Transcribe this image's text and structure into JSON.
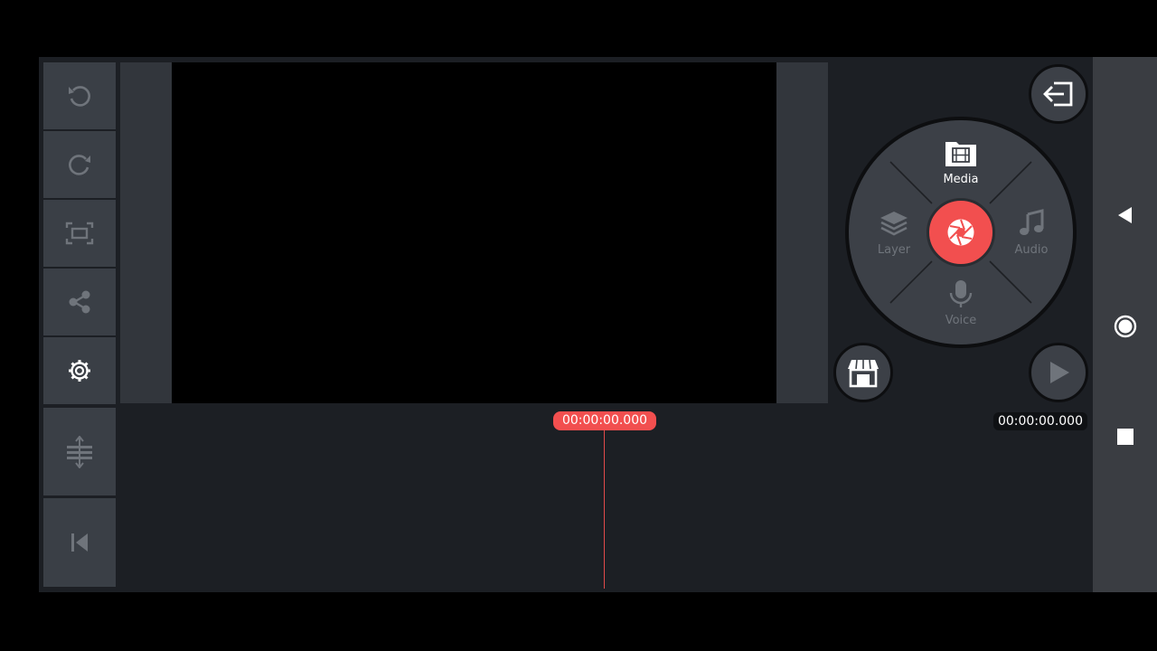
{
  "toolbar": {
    "undo_icon": "undo-icon",
    "redo_icon": "redo-icon",
    "capture_frame_icon": "capture-frame-icon",
    "share_icon": "share-icon",
    "settings_icon": "gear-icon"
  },
  "timeline_tools": {
    "adjust_icon": "adjust-tracks-icon",
    "jump_start_icon": "skip-to-start-icon"
  },
  "wheel": {
    "media": "Media",
    "layer": "Layer",
    "audio": "Audio",
    "voice": "Voice"
  },
  "timeline": {
    "current_time": "00:00:00.000",
    "total_time": "00:00:00.000"
  },
  "colors": {
    "accent": "#f24f4f",
    "panel": "#3a3f46",
    "background": "#1c1f24",
    "active_text": "#ffffff",
    "inactive_text": "#6f747b"
  }
}
